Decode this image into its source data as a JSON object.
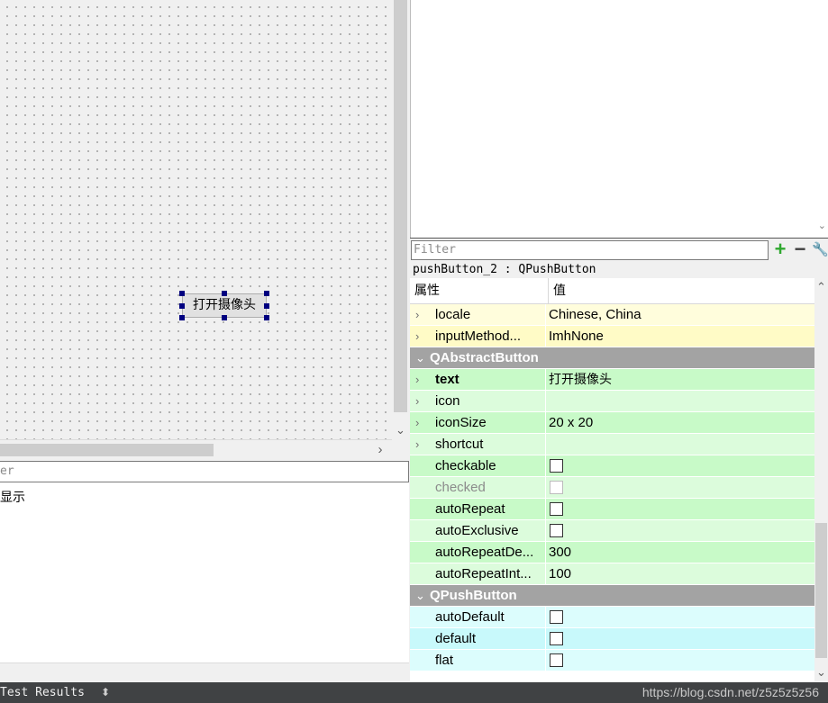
{
  "canvas": {
    "push_button_label": "打开摄像头"
  },
  "left_panel": {
    "filter_placeholder": "er",
    "output_text": "显示"
  },
  "property_editor": {
    "filter_placeholder": "Filter",
    "object_label": "pushButton_2 : QPushButton",
    "header": {
      "property": "属性",
      "value": "值"
    },
    "rows": [
      {
        "name": "locale",
        "value": "Chinese, China"
      },
      {
        "name": "inputMethod...",
        "value": "ImhNone"
      },
      {
        "name": "QAbstractButton"
      },
      {
        "name": "text",
        "value": "打开摄像头"
      },
      {
        "name": "icon",
        "value": ""
      },
      {
        "name": "iconSize",
        "value": "20 x 20"
      },
      {
        "name": "shortcut",
        "value": ""
      },
      {
        "name": "checkable",
        "checked": false
      },
      {
        "name": "checked",
        "checked": false
      },
      {
        "name": "autoRepeat",
        "checked": false
      },
      {
        "name": "autoExclusive",
        "checked": false
      },
      {
        "name": "autoRepeatDe...",
        "value": "300"
      },
      {
        "name": "autoRepeatInt...",
        "value": "100"
      },
      {
        "name": "QPushButton"
      },
      {
        "name": "autoDefault",
        "checked": false
      },
      {
        "name": "default",
        "checked": false
      },
      {
        "name": "flat",
        "checked": false
      }
    ]
  },
  "status_bar": {
    "tab_label": "Test Results",
    "watermark": "https://blog.csdn.net/z5z5z5z56"
  },
  "colors": {
    "row_yellow": "#fffddc",
    "row_yellow_alt": "#fffbc6",
    "row_green": "#c8fac8",
    "row_green_alt": "#dcfcdc",
    "row_cyan": "#dcfdfd",
    "row_cyan_alt": "#c8f9fb",
    "group_gray": "#a3a3a3",
    "status_bar": "#404244",
    "selection_handle": "#000080"
  },
  "icons": {
    "add": "plus-icon",
    "remove": "minus-icon",
    "configure": "wrench-icon",
    "expand": "chevron-right-icon",
    "collapse": "chevron-down-icon"
  }
}
